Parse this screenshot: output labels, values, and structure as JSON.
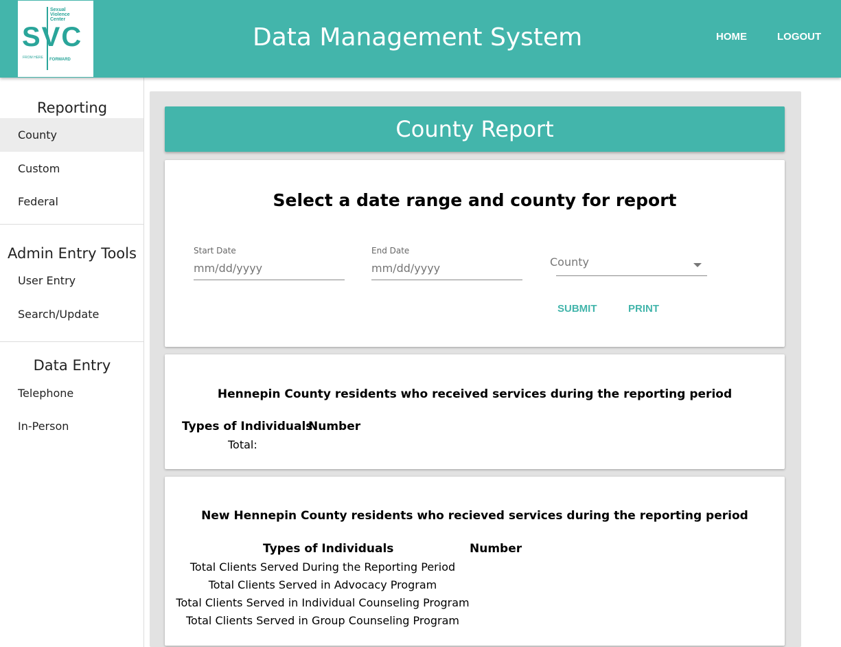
{
  "header": {
    "logo_text": "SVC",
    "logo_org_line1": "Sexual",
    "logo_org_line2": "Violence",
    "logo_org_line3": "Center",
    "logo_tag_left": "FROM HERE",
    "logo_tag_right": "FORWARD",
    "app_title": "Data Management System",
    "nav": {
      "home": "HOME",
      "logout": "LOGOUT"
    }
  },
  "sidebar": {
    "reporting": {
      "heading": "Reporting",
      "items": [
        "County",
        "Custom",
        "Federal"
      ]
    },
    "admin": {
      "heading": "Admin Entry Tools",
      "items": [
        "User Entry",
        "Search/Update"
      ]
    },
    "data_entry": {
      "heading": "Data Entry",
      "items": [
        "Telephone",
        "In-Person"
      ]
    },
    "active_item": "County"
  },
  "main": {
    "page_title": "County Report",
    "filter_card": {
      "heading": "Select a date range and county for report",
      "start_date": {
        "label": "Start Date",
        "placeholder": "mm/dd/yyyy"
      },
      "end_date": {
        "label": "End Date",
        "placeholder": "mm/dd/yyyy"
      },
      "county": {
        "selected": "County"
      },
      "submit_label": "SUBMIT",
      "print_label": "PRINT"
    },
    "residents_card": {
      "heading": "Hennepin County residents who received services during the reporting period",
      "col_types": "Types of Individuals",
      "col_number": "Number",
      "total_label": "Total:"
    },
    "new_residents_card": {
      "heading": "New Hennepin County residents who recieved services during the reporting period",
      "col_types": "Types of Individuals",
      "col_number": "Number",
      "rows": [
        "Total Clients Served During the Reporting Period",
        "Total Clients Served in Advocacy Program",
        "Total Clients Served in Individual Counseling Program",
        "Total Clients Served in Group Counseling Program"
      ]
    }
  },
  "colors": {
    "brand": "#43b5ab",
    "panel": "#e2e2e2",
    "active_bg": "#ececec"
  }
}
